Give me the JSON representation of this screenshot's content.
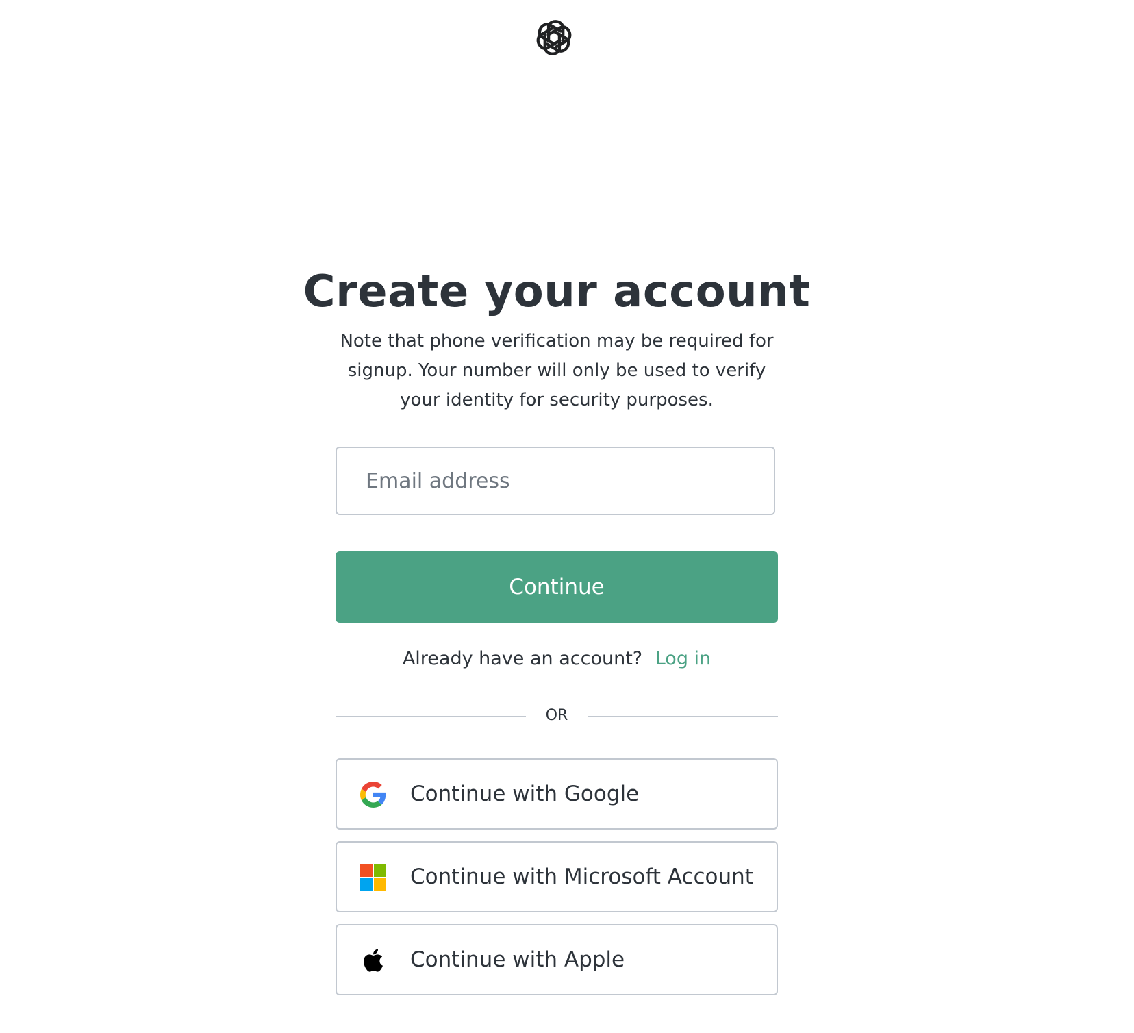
{
  "brand": {
    "logo_icon": "openai-logo-icon",
    "accent_color": "#4ba284"
  },
  "heading": {
    "title": "Create your account",
    "subtitle_lines": [
      "Note that phone verification may be required for",
      "signup. Your number will only be used to verify",
      "your identity for security purposes."
    ]
  },
  "form": {
    "email_placeholder": "Email address",
    "email_value": "",
    "continue_label": "Continue"
  },
  "login": {
    "prompt": "Already have an account?",
    "link_label": "Log in"
  },
  "divider": {
    "label": "OR"
  },
  "social": [
    {
      "label": "Continue with Google",
      "icon": "google-icon"
    },
    {
      "label": "Continue with Microsoft Account",
      "icon": "microsoft-icon"
    },
    {
      "label": "Continue with Apple",
      "icon": "apple-icon"
    }
  ]
}
